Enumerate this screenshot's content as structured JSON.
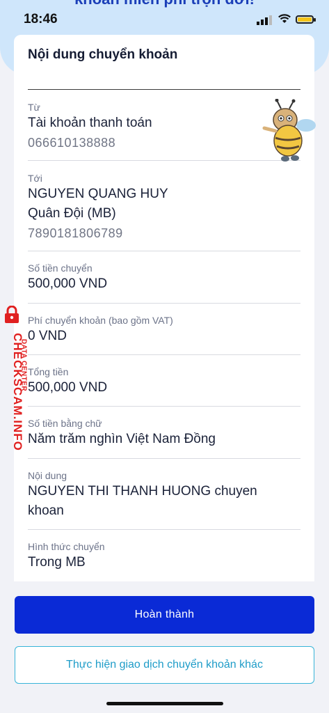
{
  "promo_text": "khoản miễn phí trọn đời!",
  "status": {
    "time": "18:46"
  },
  "card": {
    "title": "Nội dung chuyển khoản",
    "fields": [
      {
        "label": "Từ",
        "value": "Tài khoản thanh toán",
        "sub": "066610138888"
      },
      {
        "label": "Tới",
        "value": "NGUYEN QUANG HUY",
        "value2": "Quân Đội (MB)",
        "sub": "7890181806789"
      },
      {
        "label": "Số tiền chuyển",
        "value": "500,000 VND"
      },
      {
        "label": "Phí chuyển khoản (bao gồm VAT)",
        "value": "0 VND"
      },
      {
        "label": "Tổng tiền",
        "value": "500,000 VND"
      },
      {
        "label": "Số tiền bằng chữ",
        "value": "Năm trăm nghìn Việt Nam Đồng"
      },
      {
        "label": "Nội dung",
        "value": "NGUYEN THI THANH HUONG chuyen",
        "value2": "khoan"
      },
      {
        "label": "Hình thức chuyển",
        "value": "Trong MB"
      }
    ]
  },
  "watermark": {
    "main": "CHECKSCAM.INFO",
    "sub": "DATA CENTER"
  },
  "buttons": {
    "primary": "Hoàn thành",
    "secondary": "Thực hiện giao dịch chuyển khoản khác"
  },
  "icons": {
    "signal": "cellular-signal-icon",
    "wifi": "wifi-icon",
    "battery": "battery-icon",
    "mascot": "bee-mascot-icon",
    "lock": "lock-icon"
  },
  "colors": {
    "primary_button": "#0a2ad6",
    "secondary_border": "#37b4d8",
    "watermark": "#e02020",
    "top_band": "#cfe6fb"
  }
}
